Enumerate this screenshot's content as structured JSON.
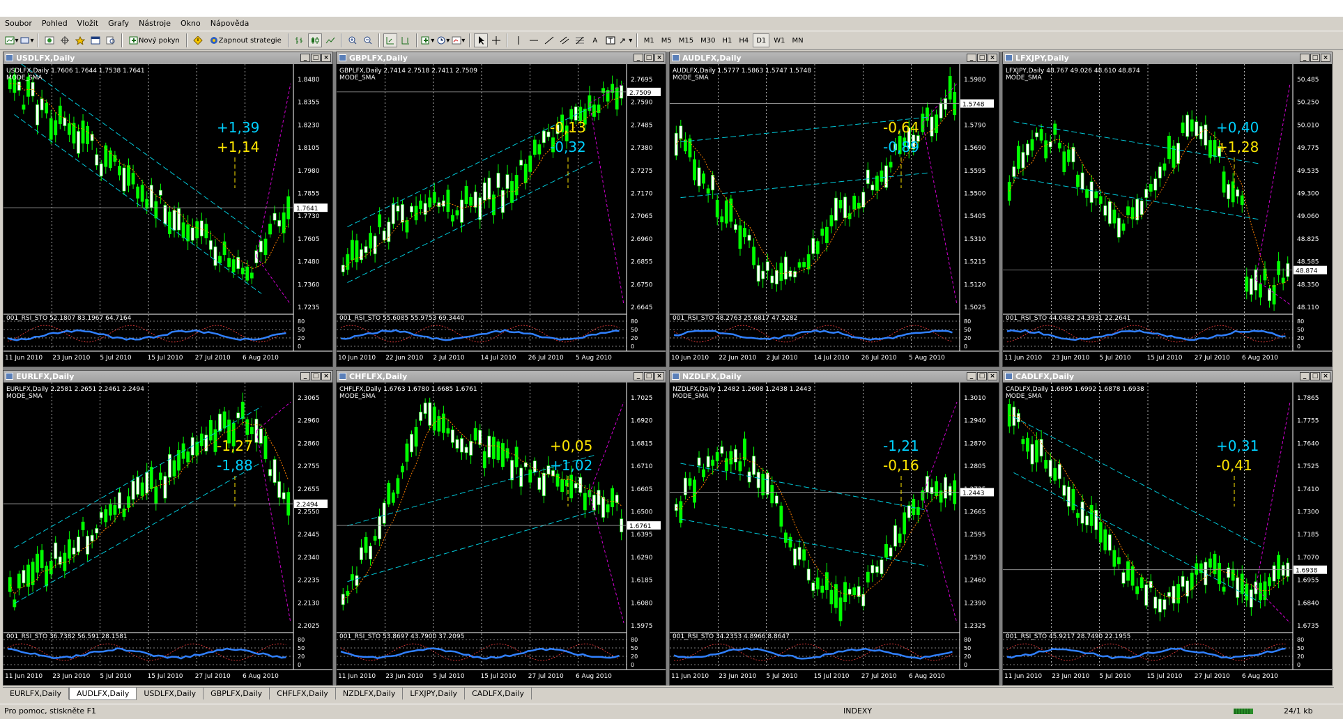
{
  "menu": [
    "Soubor",
    "Pohled",
    "Vložit",
    "Grafy",
    "Nástroje",
    "Okno",
    "Nápověda"
  ],
  "toolbar": {
    "new_order": "Nový pokyn",
    "strategy": "Zapnout strategie",
    "text_tool": "A",
    "periods": [
      "M1",
      "M5",
      "M15",
      "M30",
      "H1",
      "H4",
      "D1",
      "W1",
      "MN"
    ],
    "active_period": "D1"
  },
  "charts": [
    {
      "title": "USDLFX,Daily",
      "header": "USDLFX,Daily  1.7606 1.7644 1.7538 1.7641",
      "mode": "MODE_SMA",
      "osc": "001_RSI_STO 52.1807 83.1967 64.7164",
      "prices": [
        "1.8480",
        "1.8355",
        "1.8230",
        "1.8105",
        "1.7980",
        "1.7855",
        "1.7730",
        "1.7605",
        "1.7480",
        "1.7360",
        "1.7235"
      ],
      "last": "1.7641",
      "dates": [
        "11 Jun 2010",
        "23 Jun 2010",
        "5 Jul 2010",
        "15 Jul 2010",
        "27 Jul 2010",
        "6 Aug 2010"
      ],
      "ann1": "+1,39",
      "ann2": "+1,14",
      "c1": "#00d0ff",
      "c2": "#ffe600",
      "trend": "down-up",
      "seed": 1
    },
    {
      "title": "GBPLFX,Daily",
      "header": "GBPLFX,Daily  2.7414 2.7518 2.7411 2.7509",
      "mode": "MODE_SMA",
      "osc": "001_RSI_STO 55.6085 55.9753 69.3440",
      "prices": [
        "2.7695",
        "2.7590",
        "2.7485",
        "2.7380",
        "2.7275",
        "2.7170",
        "2.7065",
        "2.6960",
        "2.6855",
        "2.6750",
        "2.6645"
      ],
      "last": "2.7509",
      "dates": [
        "10 Jun 2010",
        "22 Jun 2010",
        "2 Jul 2010",
        "14 Jul 2010",
        "26 Jul 2010",
        "5 Aug 2010"
      ],
      "ann1": "-0,13",
      "ann2": "-0,32",
      "c1": "#ffe600",
      "c2": "#00d0ff",
      "trend": "up",
      "seed": 2
    },
    {
      "title": "AUDLFX,Daily",
      "header": "AUDLFX,Daily  1.5777 1.5863 1.5747 1.5748",
      "mode": "MODE_SMA",
      "osc": "001_RSI_STO 48.2763 25.6817 47.5282",
      "prices": [
        "1.5980",
        "1.5885",
        "1.5790",
        "1.5690",
        "1.5595",
        "1.5500",
        "1.5405",
        "1.5310",
        "1.5215",
        "1.5120",
        "1.5025"
      ],
      "last": "1.5748",
      "dates": [
        "10 Jun 2010",
        "22 Jun 2010",
        "2 Jul 2010",
        "14 Jul 2010",
        "26 Jul 2010",
        "5 Aug 2010"
      ],
      "ann1": "-0,64",
      "ann2": "-0,89",
      "c1": "#ffe600",
      "c2": "#00d0ff",
      "trend": "vup",
      "seed": 3
    },
    {
      "title": "LFXJPY,Daily",
      "header": "LFXJPY,Daily  48.767 49.026 48.610 48.874",
      "mode": "MODE_SMA",
      "osc": "001_RSI_STO 44.0482 24.3931 22.2641",
      "prices": [
        "50.485",
        "50.250",
        "50.010",
        "49.775",
        "49.535",
        "49.300",
        "49.060",
        "48.825",
        "48.585",
        "48.350",
        "48.110"
      ],
      "last": "48.874",
      "dates": [
        "11 Jun 2010",
        "23 Jun 2010",
        "5 Jul 2010",
        "15 Jul 2010",
        "27 Jul 2010",
        "6 Aug 2010"
      ],
      "ann1": "+0,40",
      "ann2": "+1,28",
      "c1": "#00d0ff",
      "c2": "#ffe600",
      "trend": "range",
      "seed": 4
    },
    {
      "title": "EURLFX,Daily",
      "header": "EURLFX,Daily  2.2581 2.2651 2.2461 2.2494",
      "mode": "MODE_SMA",
      "osc": "001_RSI_STO 36.7382 56.591 28.1581",
      "prices": [
        "2.3065",
        "2.2960",
        "2.2860",
        "2.2755",
        "2.2655",
        "2.2550",
        "2.2445",
        "2.2340",
        "2.2235",
        "2.2130",
        "2.2025"
      ],
      "last": "2.2494",
      "dates": [
        "11 Jun 2010",
        "23 Jun 2010",
        "5 Jul 2010",
        "15 Jul 2010",
        "27 Jul 2010",
        "6 Aug 2010"
      ],
      "ann1": "-1,27",
      "ann2": "-1,88",
      "c1": "#ffe600",
      "c2": "#00d0ff",
      "trend": "upthendown",
      "seed": 5
    },
    {
      "title": "CHFLFX,Daily",
      "header": "CHFLFX,Daily  1.6763 1.6780 1.6685 1.6761",
      "mode": "MODE_SMA",
      "osc": "001_RSI_STO 53.8697 43.7900 37.2095",
      "prices": [
        "1.7025",
        "1.6920",
        "1.6815",
        "1.6710",
        "1.6605",
        "1.6500",
        "1.6395",
        "1.6290",
        "1.6185",
        "1.6080",
        "1.5975"
      ],
      "last": "1.6761",
      "dates": [
        "11 Jun 2010",
        "23 Jun 2010",
        "5 Jul 2010",
        "15 Jul 2010",
        "27 Jul 2010",
        "6 Aug 2010"
      ],
      "ann1": "+0,05",
      "ann2": "+1,02",
      "c1": "#ffe600",
      "c2": "#00d0ff",
      "trend": "upflat",
      "seed": 6
    },
    {
      "title": "NZDLFX,Daily",
      "header": "NZDLFX,Daily  1.2482 1.2608 1.2438 1.2443",
      "mode": "MODE_SMA",
      "osc": "001_RSI_STO 34.2353 4.8966 8.8647",
      "prices": [
        "1.3010",
        "1.2940",
        "1.2870",
        "1.2805",
        "1.2735",
        "1.2665",
        "1.2595",
        "1.2530",
        "1.2460",
        "1.2390",
        "1.2325"
      ],
      "last": "1.2443",
      "dates": [
        "11 Jun 2010",
        "23 Jun 2010",
        "5 Jul 2010",
        "15 Jul 2010",
        "27 Jul 2010",
        "6 Aug 2010"
      ],
      "ann1": "-1,21",
      "ann2": "-0,16",
      "c1": "#00d0ff",
      "c2": "#ffe600",
      "trend": "wave",
      "seed": 7
    },
    {
      "title": "CADLFX,Daily",
      "header": "CADLFX,Daily  1.6895 1.6992 1.6878 1.6938",
      "mode": "MODE_SMA",
      "osc": "001_RSI_STO 45.9217 28.7490 22.1955",
      "prices": [
        "1.7865",
        "1.7755",
        "1.7640",
        "1.7525",
        "1.7410",
        "1.7300",
        "1.7185",
        "1.7070",
        "1.6955",
        "1.6840",
        "1.6735"
      ],
      "last": "1.6938",
      "dates": [
        "11 Jun 2010",
        "23 Jun 2010",
        "5 Jul 2010",
        "15 Jul 2010",
        "27 Jul 2010",
        "6 Aug 2010"
      ],
      "ann1": "+0,31",
      "ann2": "-0,41",
      "c1": "#00d0ff",
      "c2": "#ffe600",
      "trend": "down",
      "seed": 8
    }
  ],
  "tabs": [
    "EURLFX,Daily",
    "AUDLFX,Daily",
    "USDLFX,Daily",
    "GBPLFX,Daily",
    "CHFLFX,Daily",
    "NZDLFX,Daily",
    "LFXJPY,Daily",
    "CADLFX,Daily"
  ],
  "active_tab": "AUDLFX,Daily",
  "status": {
    "help": "Pro pomoc, stiskněte F1",
    "profile": "INDEXY",
    "traffic": "24/1 kb"
  },
  "osc_levels": [
    "80",
    "50",
    "20",
    "0"
  ],
  "colors": {
    "bull": "#00ff00",
    "bear": "#ffffff",
    "trend": "#00c8d8",
    "fan": "#d000d0",
    "ma": "#ff8000",
    "osc_main": "#3080ff"
  }
}
